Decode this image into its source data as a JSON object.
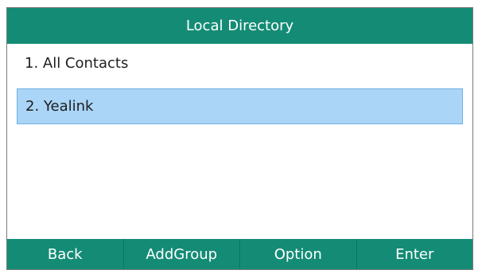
{
  "header": {
    "title": "Local Directory"
  },
  "list": {
    "items": [
      {
        "label": "1. All Contacts",
        "selected": false
      },
      {
        "label": "2. Yealink",
        "selected": true
      }
    ]
  },
  "softkeys": [
    {
      "label": "Back"
    },
    {
      "label": "AddGroup"
    },
    {
      "label": "Option"
    },
    {
      "label": "Enter"
    }
  ],
  "colors": {
    "accent": "#148c75",
    "selection": "#aad5f7"
  }
}
